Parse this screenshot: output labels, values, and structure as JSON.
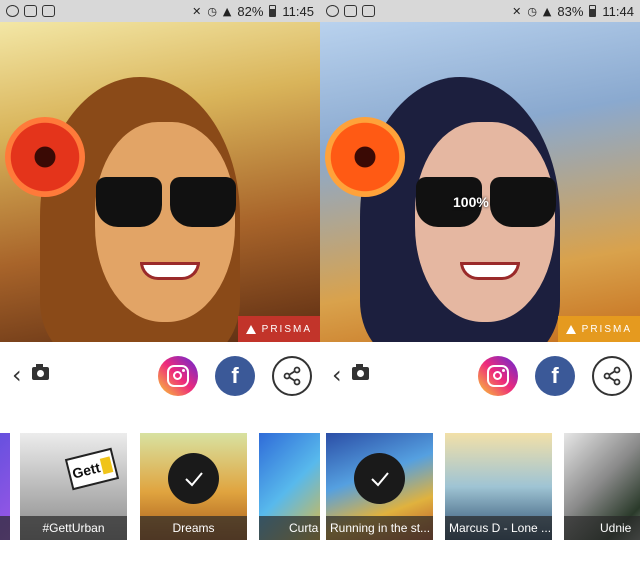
{
  "left": {
    "status": {
      "battery": "82%",
      "time": "11:45"
    },
    "brand": "PRISMA",
    "filters": [
      {
        "label": ""
      },
      {
        "label": "#GettUrban",
        "sign": "Gett"
      },
      {
        "label": "Dreams",
        "selected": true
      },
      {
        "label": "Curta"
      }
    ]
  },
  "right": {
    "status": {
      "battery": "83%",
      "time": "11:44"
    },
    "brand": "PRISMA",
    "intensity": "100%",
    "filters": [
      {
        "label": "Running in the st...",
        "selected": true
      },
      {
        "label": "Marcus D - Lone ..."
      },
      {
        "label": "Udnie"
      }
    ]
  },
  "colors": {
    "brand_left": "#c2342a",
    "brand_right": "#e59a1f",
    "facebook": "#3b5998"
  },
  "icons": [
    "back-chevron-icon",
    "camera-icon",
    "instagram-icon",
    "facebook-icon",
    "share-icon",
    "check-icon",
    "prisma-logo-icon"
  ]
}
